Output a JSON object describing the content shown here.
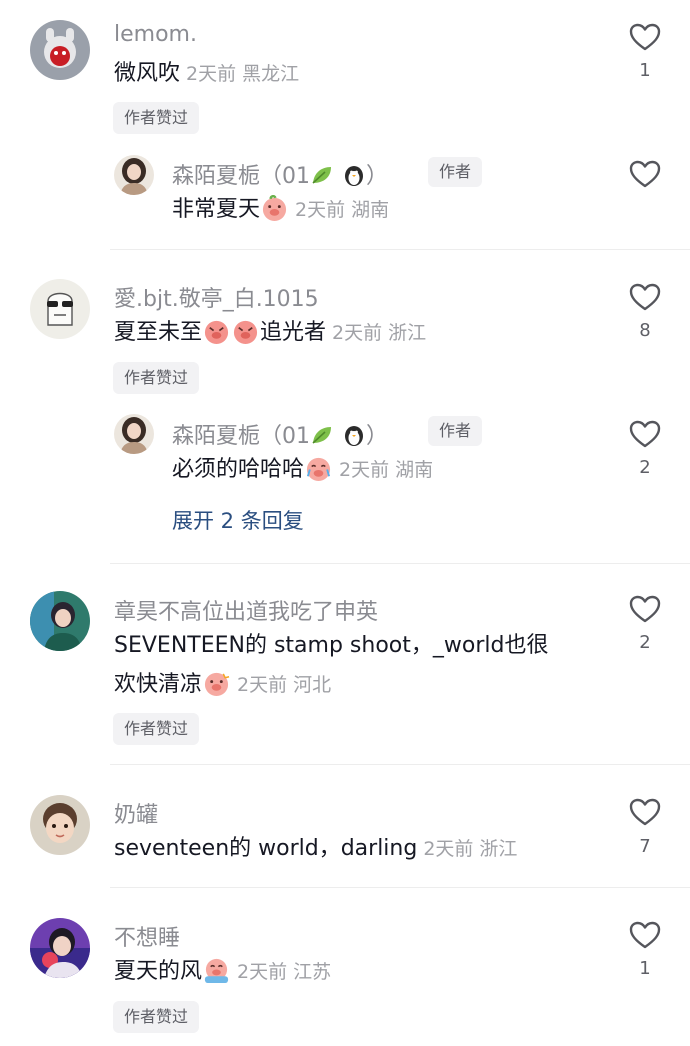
{
  "comments": [
    {
      "username": "lemom.",
      "text": "微风吹",
      "time": "2天前",
      "location": "黑龙江",
      "likes": "1",
      "author_liked": "作者赞过"
    },
    {
      "username": "愛.bjt.敬亭_白.1015",
      "text_a": "夏至未至",
      "text_b": "追光者",
      "time": "2天前",
      "location": "浙江",
      "likes": "8",
      "author_liked": "作者赞过"
    },
    {
      "username": "章昊不高位出道我吃了申英",
      "text_line1": "SEVENTEEN的 stamp shoot，_world也很",
      "text_line2": "欢快清凉",
      "time": "2天前",
      "location": "河北",
      "likes": "2",
      "author_liked": "作者赞过"
    },
    {
      "username": "奶罐",
      "text": "seventeen的 world，darling",
      "time": "2天前",
      "location": "浙江",
      "likes": "7"
    },
    {
      "username": "不想睡",
      "text": "夏天的风",
      "time": "2天前",
      "location": "江苏",
      "likes": "1",
      "author_liked": "作者赞过"
    }
  ],
  "replies": [
    {
      "username_prefix": "森陌夏栀（01",
      "username_suffix": "）",
      "author_tag": "作者",
      "text": "非常夏天",
      "time": "2天前",
      "location": "湖南",
      "likes": ""
    },
    {
      "username_prefix": "森陌夏栀（01",
      "username_suffix": "）",
      "author_tag": "作者",
      "text": "必须的哈哈哈",
      "time": "2天前",
      "location": "湖南",
      "likes": "2"
    }
  ],
  "expand_replies": "展开 2 条回复",
  "icons": {
    "like": "heart-outline-icon",
    "leaf": "leaf-emoji-icon",
    "penguin": "penguin-emoji-icon",
    "emoji": "pig-face-emoji-icon"
  }
}
